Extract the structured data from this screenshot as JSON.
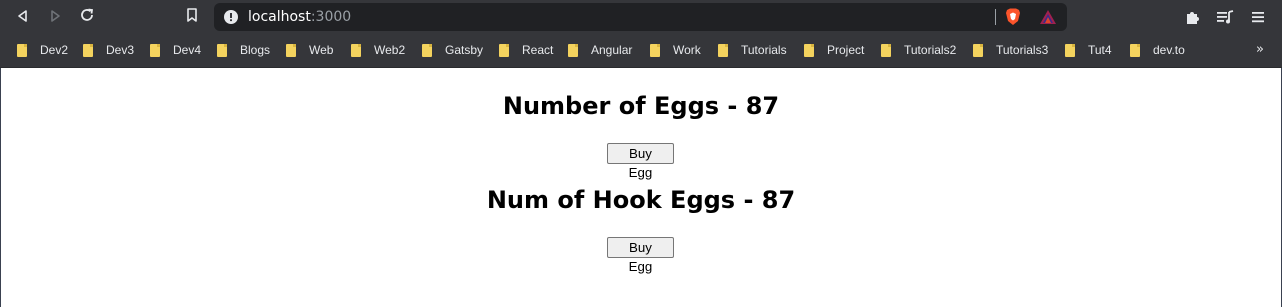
{
  "browser": {
    "address": {
      "host": "localhost",
      "port": ":3000"
    },
    "icons": [
      "back-icon",
      "forward-icon",
      "reload-icon",
      "bookmark-icon",
      "info-icon",
      "brave-shield-icon",
      "brave-rewards-icon",
      "extensions-icon",
      "reading-list-icon",
      "menu-icon"
    ],
    "colors": {
      "toolbar": "#35363a",
      "omnibox": "#202124",
      "folder": "#f4d35e"
    }
  },
  "bookmarks": [
    {
      "label": "Dev2"
    },
    {
      "label": "Dev3"
    },
    {
      "label": "Dev4"
    },
    {
      "label": "Blogs"
    },
    {
      "label": "Web"
    },
    {
      "label": "Web2"
    },
    {
      "label": "Gatsby"
    },
    {
      "label": "React"
    },
    {
      "label": "Angular"
    },
    {
      "label": "Work"
    },
    {
      "label": "Tutorials"
    },
    {
      "label": "Project"
    },
    {
      "label": "Tutorials2"
    },
    {
      "label": "Tutorials3"
    },
    {
      "label": "Tut4"
    },
    {
      "label": "dev.to"
    }
  ],
  "bookmarks_more": "»",
  "page": {
    "eggs_heading": "Number of Eggs - 87",
    "eggs_button": "Buy Egg",
    "hook_heading": "Num of Hook Eggs - 87",
    "hook_button": "Buy Egg"
  }
}
